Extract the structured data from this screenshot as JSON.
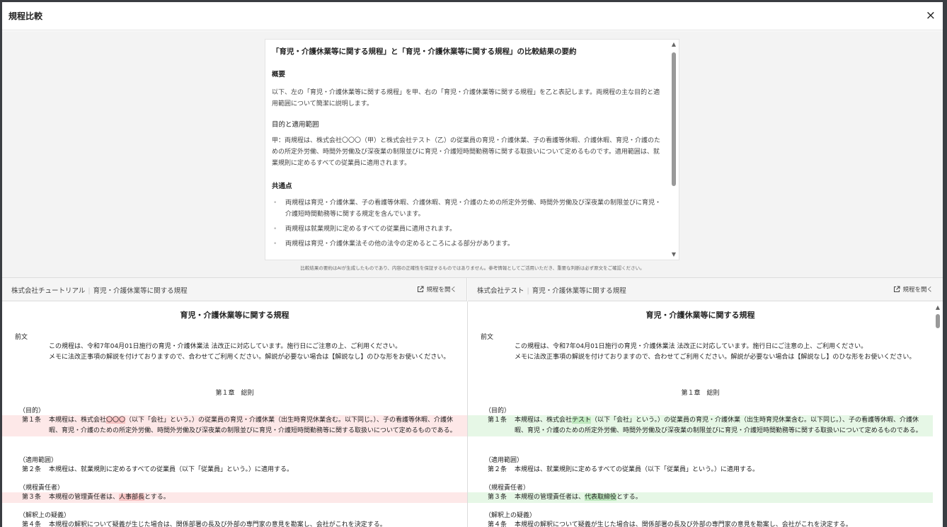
{
  "modal": {
    "title": "規程比較",
    "close_label": "×"
  },
  "summary": {
    "title": "「育児・介護休業等に関する規程」と「育児・介護休業等に関する規程」の比較結果の要約",
    "overview_heading": "概要",
    "overview_text": "以下、左の「育児・介護休業等に関する規程」を甲、右の「育児・介護休業等に関する規程」を乙と表記します。両規程の主な目的と適用範囲について簡潔に説明します。",
    "purpose_heading": "目的と適用範囲",
    "purpose_text": "甲：両規程は、株式会社〇〇〇（甲）と株式会社テスト（乙）の従業員の育児・介護休業、子の看護等休暇、介護休暇、育児・介護のための所定外労働、時間外労働及び深夜業の制限並びに育児・介護短時間勤務等に関する取扱いについて定めるものです。適用範囲は、就業規則に定めるすべての従業員に適用されます。",
    "common_heading": "共通点",
    "bullet_marker": "•",
    "common_points": [
      "両規程は育児・介護休業、子の看護等休暇、介護休暇、育児・介護のための所定外労働、時間外労働及び深夜業の制限並びに育児・介護短時間勤務等に関する規定を含んでいます。",
      "両規程は就業規則に定めるすべての従業員に適用されます。",
      "両規程は育児・介護休業法その他の法令の定めるところによる部分があります。"
    ],
    "scroll_up": "▲",
    "scroll_down": "▼",
    "disclaimer": "比較結果の要約はAIが生成したものであり、内容の正確性を保証するものではありません。参考情報としてご活用いただき、重要な判断は必ず原文をご確認ください。"
  },
  "left": {
    "company": "株式会社チュートリアル",
    "separator": "|",
    "doc_name": "育児・介護休業等に関する規程",
    "open_label": "規程を開く",
    "doc_title": "育児・介護休業等に関する規程",
    "preamble_label": "前文",
    "preamble_line1": "この規程は、令和7年04月01日施行の育児・介護休業法 法改正に対応しています。施行日にご注意の上、ご利用ください。",
    "preamble_line2": "メモに法改正事項の解説を付けておりますので、合わせてご利用ください。解説が必要ない場合は【解説なし】のひな形をお使いください。",
    "chapter": "第１章　総則",
    "a1_caption": "（目的）",
    "a1_num": "第１条",
    "a1_pre": "本規程は、株式会社",
    "a1_hl": "〇〇〇",
    "a1_post": "（以下「会社」という。）の従業員の育児・介護休業（出生時育児休業含む。以下同じ。）、子の看護等休暇、介護休暇、育児・介護のための所定外労働、時間外労働及び深夜業の制限並びに育児・介護短時間勤務等に関する取扱いについて定めるものである。",
    "a2_caption": "（適用範囲）",
    "a2_num": "第２条",
    "a2_text": "本規程は、就業規則に定めるすべての従業員（以下「従業員」という。）に適用する。",
    "a3_caption": "（規程責任者）",
    "a3_num": "第３条",
    "a3_pre": "本規程の管理責任者は、",
    "a3_hl": "人事部長",
    "a3_post": "とする。",
    "a4_caption": "（解釈上の疑義）",
    "a4_num": "第４条",
    "a4_text": "本規程の解釈について疑義が生じた場合は、関係部署の長及び外部の専門家の意見を勘案し、会社がこれを決定する。"
  },
  "right": {
    "company": "株式会社テスト",
    "separator": "|",
    "doc_name": "育児・介護休業等に関する規程",
    "open_label": "規程を開く",
    "doc_title": "育児・介護休業等に関する規程",
    "preamble_label": "前文",
    "preamble_line1": "この規程は、令和7年04月01日施行の育児・介護休業法 法改正に対応しています。施行日にご注意の上、ご利用ください。",
    "preamble_line2": "メモに法改正事項の解説を付けておりますので、合わせてご利用ください。解説が必要ない場合は【解説なし】のひな形をお使いください。",
    "chapter": "第１章　総則",
    "a1_caption": "（目的）",
    "a1_num": "第１条",
    "a1_pre": "本規程は、株式会社",
    "a1_hl": "テスト",
    "a1_post": "（以下「会社」という。）の従業員の育児・介護休業（出生時育児休業含む。以下同じ。）、子の看護等休暇、介護休暇、育児・介護のための所定外労働、時間外労働及び深夜業の制限並びに育児・介護短時間勤務等に関する取扱いについて定めるものである。",
    "a2_caption": "（適用範囲）",
    "a2_num": "第２条",
    "a2_text": "本規程は、就業規則に定めるすべての従業員（以下「従業員」という。）に適用する。",
    "a3_caption": "（規程責任者）",
    "a3_num": "第３条",
    "a3_pre": "本規程の管理責任者は、",
    "a3_hl": "代表取締役",
    "a3_post": "とする。",
    "a4_caption": "（解釈上の疑義）",
    "a4_num": "第４条",
    "a4_text": "本規程の解釈について疑義が生じた場合は、関係部署の長及び外部の専門家の意見を勘案し、会社がこれを決定する。",
    "scroll_up": "▲"
  },
  "colors": {
    "deleted_bg": "#fde8e8",
    "deleted_highlight": "#f7c4c4",
    "added_bg": "#e6f7e6",
    "added_highlight": "#bfe9bf"
  }
}
